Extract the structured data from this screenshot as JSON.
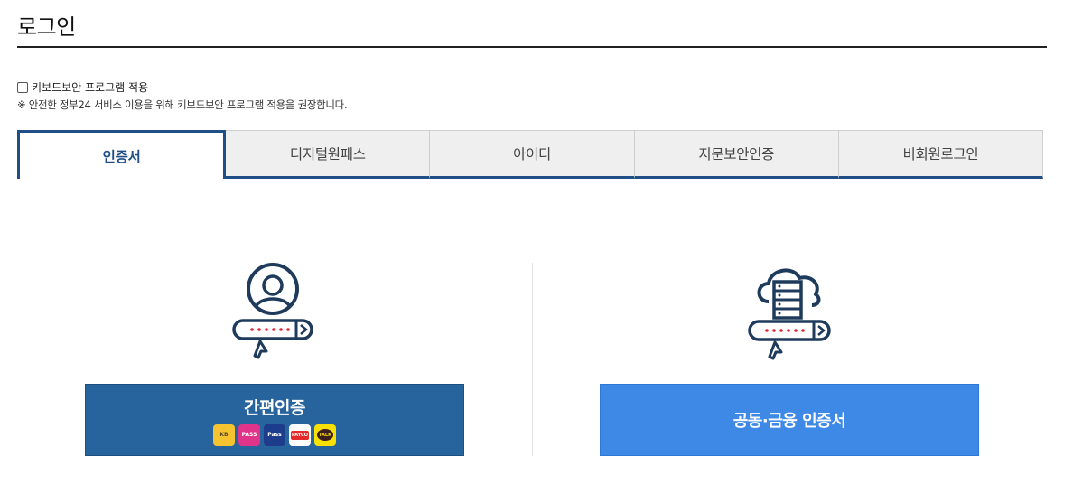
{
  "page": {
    "title": "로그인"
  },
  "keyboard_security": {
    "checkbox_label": "키보드보안 프로그램 적용",
    "checked": false,
    "note": "※ 안전한 정부24 서비스 이용을 위해 키보드보안 프로그램 적용을 권장합니다."
  },
  "tabs": [
    {
      "label": "인증서",
      "active": true
    },
    {
      "label": "디지털원패스",
      "active": false
    },
    {
      "label": "아이디",
      "active": false
    },
    {
      "label": "지문보안인증",
      "active": false
    },
    {
      "label": "비회원로그인",
      "active": false
    }
  ],
  "options": {
    "simple_auth": {
      "label": "간편인증",
      "icon": "user-password-login-icon",
      "providers": [
        {
          "name": "kb-mobile-icon",
          "text": "KB"
        },
        {
          "name": "pass-icon",
          "text": "PASS"
        },
        {
          "name": "samsung-pass-icon",
          "text": "Pass"
        },
        {
          "name": "payco-icon",
          "text": "PAYCO"
        },
        {
          "name": "kakaotalk-icon",
          "text": "TALK"
        }
      ]
    },
    "joint_cert": {
      "label": "공동·금융 인증서",
      "icon": "cloud-server-password-icon"
    }
  },
  "colors": {
    "primary_navy": "#1f4f86",
    "simple_auth_bg": "#27639c",
    "joint_cert_bg": "#3f89e6",
    "password_dots": "#e0283a"
  }
}
